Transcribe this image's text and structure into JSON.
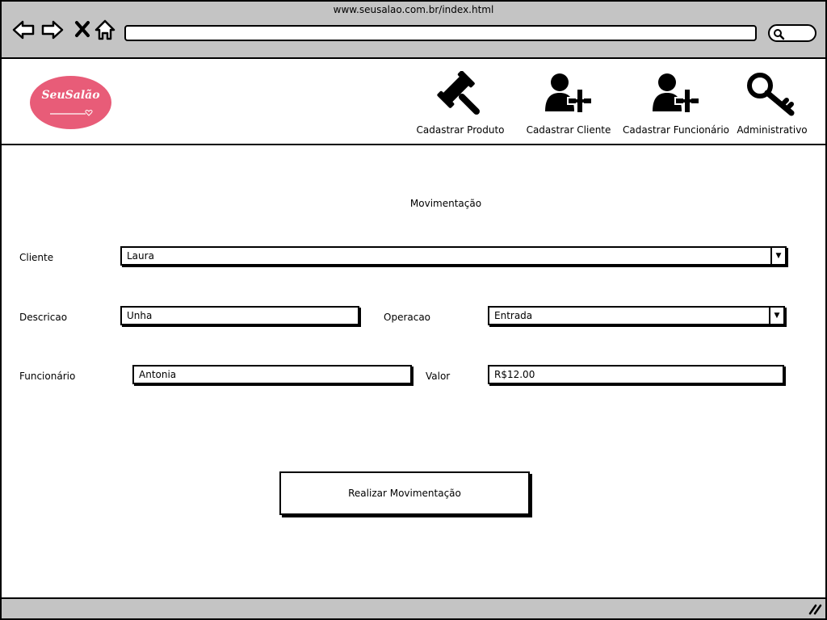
{
  "browser": {
    "url": "www.seusalao.com.br/index.html",
    "icons": [
      "back-arrow-icon",
      "forward-arrow-icon",
      "close-x-icon",
      "home-icon",
      "search-icon"
    ]
  },
  "header": {
    "logo_text": "SeuSalão",
    "logo_color": "#e85c78",
    "nav": [
      {
        "label": "Cadastrar Produto",
        "icon": "gavel-icon"
      },
      {
        "label": "Cadastrar Cliente",
        "icon": "user-add-icon"
      },
      {
        "label": "Cadastrar Funcionário",
        "icon": "user-add-icon"
      },
      {
        "label": "Administrativo",
        "icon": "key-icon"
      }
    ]
  },
  "form": {
    "title": "Movimentação",
    "cliente_label": "Cliente",
    "cliente_value": "Laura",
    "descricao_label": "Descricao",
    "descricao_value": "Unha",
    "operacao_label": "Operacao",
    "operacao_value": "Entrada",
    "funcionario_label": "Funcionário",
    "funcionario_value": "Antonia",
    "valor_label": "Valor",
    "valor_value": "R$12.00",
    "submit_label": "Realizar Movimentação"
  }
}
